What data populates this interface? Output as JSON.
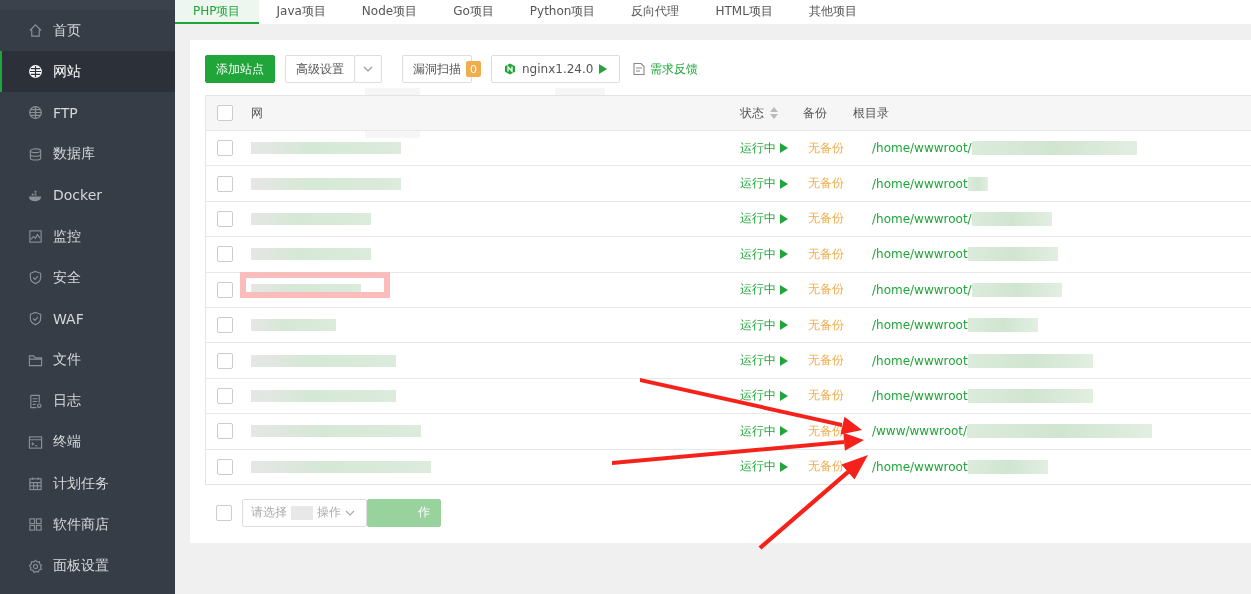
{
  "sidebar": {
    "items": [
      {
        "label": "首页",
        "kind": "home",
        "selected": false
      },
      {
        "label": "网站",
        "kind": "globe",
        "selected": true
      },
      {
        "label": "FTP",
        "kind": "globe",
        "selected": false
      },
      {
        "label": "数据库",
        "kind": "database",
        "selected": false
      },
      {
        "label": "Docker",
        "kind": "whale",
        "selected": false
      },
      {
        "label": "监控",
        "kind": "monitor",
        "selected": false
      },
      {
        "label": "安全",
        "kind": "shield",
        "selected": false
      },
      {
        "label": "WAF",
        "kind": "shield",
        "selected": false
      },
      {
        "label": "文件",
        "kind": "folder",
        "selected": false
      },
      {
        "label": "日志",
        "kind": "log",
        "selected": false
      },
      {
        "label": "终端",
        "kind": "terminal",
        "selected": false
      },
      {
        "label": "计划任务",
        "kind": "calendar",
        "selected": false
      },
      {
        "label": "软件商店",
        "kind": "grid",
        "selected": false
      },
      {
        "label": "面板设置",
        "kind": "gear",
        "selected": false
      }
    ]
  },
  "tabs": [
    {
      "label": "PHP项目",
      "selected": true
    },
    {
      "label": "Java项目",
      "selected": false
    },
    {
      "label": "Node项目",
      "selected": false
    },
    {
      "label": "Go项目",
      "selected": false
    },
    {
      "label": "Python项目",
      "selected": false
    },
    {
      "label": "反向代理",
      "selected": false
    },
    {
      "label": "HTML项目",
      "selected": false
    },
    {
      "label": "其他项目",
      "selected": false
    }
  ],
  "toolbar": {
    "add_site": "添加站点",
    "advanced": "高级设置",
    "scan": "漏洞扫描",
    "scan_count": "0",
    "nginx": "nginx1.24.0",
    "feedback": "需求反馈"
  },
  "table": {
    "select_all_checked": false,
    "columns": [
      "网",
      "状态",
      "备份",
      "根目录"
    ],
    "rows": [
      {
        "checked": false,
        "status": "运行中",
        "backup": "无备份",
        "root": "/home/wwwroot/"
      },
      {
        "checked": false,
        "status": "运行中",
        "backup": "无备份",
        "root": "/home/wwwroot"
      },
      {
        "checked": false,
        "status": "运行中",
        "backup": "无备份",
        "root": "/home/wwwroot/"
      },
      {
        "checked": false,
        "status": "运行中",
        "backup": "无备份",
        "root": "/home/wwwroot"
      },
      {
        "checked": false,
        "status": "运行中",
        "backup": "无备份",
        "root": "/home/wwwroot/"
      },
      {
        "checked": false,
        "status": "运行中",
        "backup": "无备份",
        "root": "/home/wwwroot"
      },
      {
        "checked": false,
        "status": "运行中",
        "backup": "无备份",
        "root": "/home/wwwroot"
      },
      {
        "checked": false,
        "status": "运行中",
        "backup": "无备份",
        "root": "/home/wwwroot"
      },
      {
        "checked": false,
        "status": "运行中",
        "backup": "无备份",
        "root": "/www/wwwroot/"
      },
      {
        "checked": false,
        "status": "运行中",
        "backup": "无备份",
        "root": "/home/wwwroot"
      }
    ]
  },
  "footer": {
    "checked": false,
    "select_placeholder": "请选择",
    "select_suffix": "操作",
    "button": "作"
  }
}
